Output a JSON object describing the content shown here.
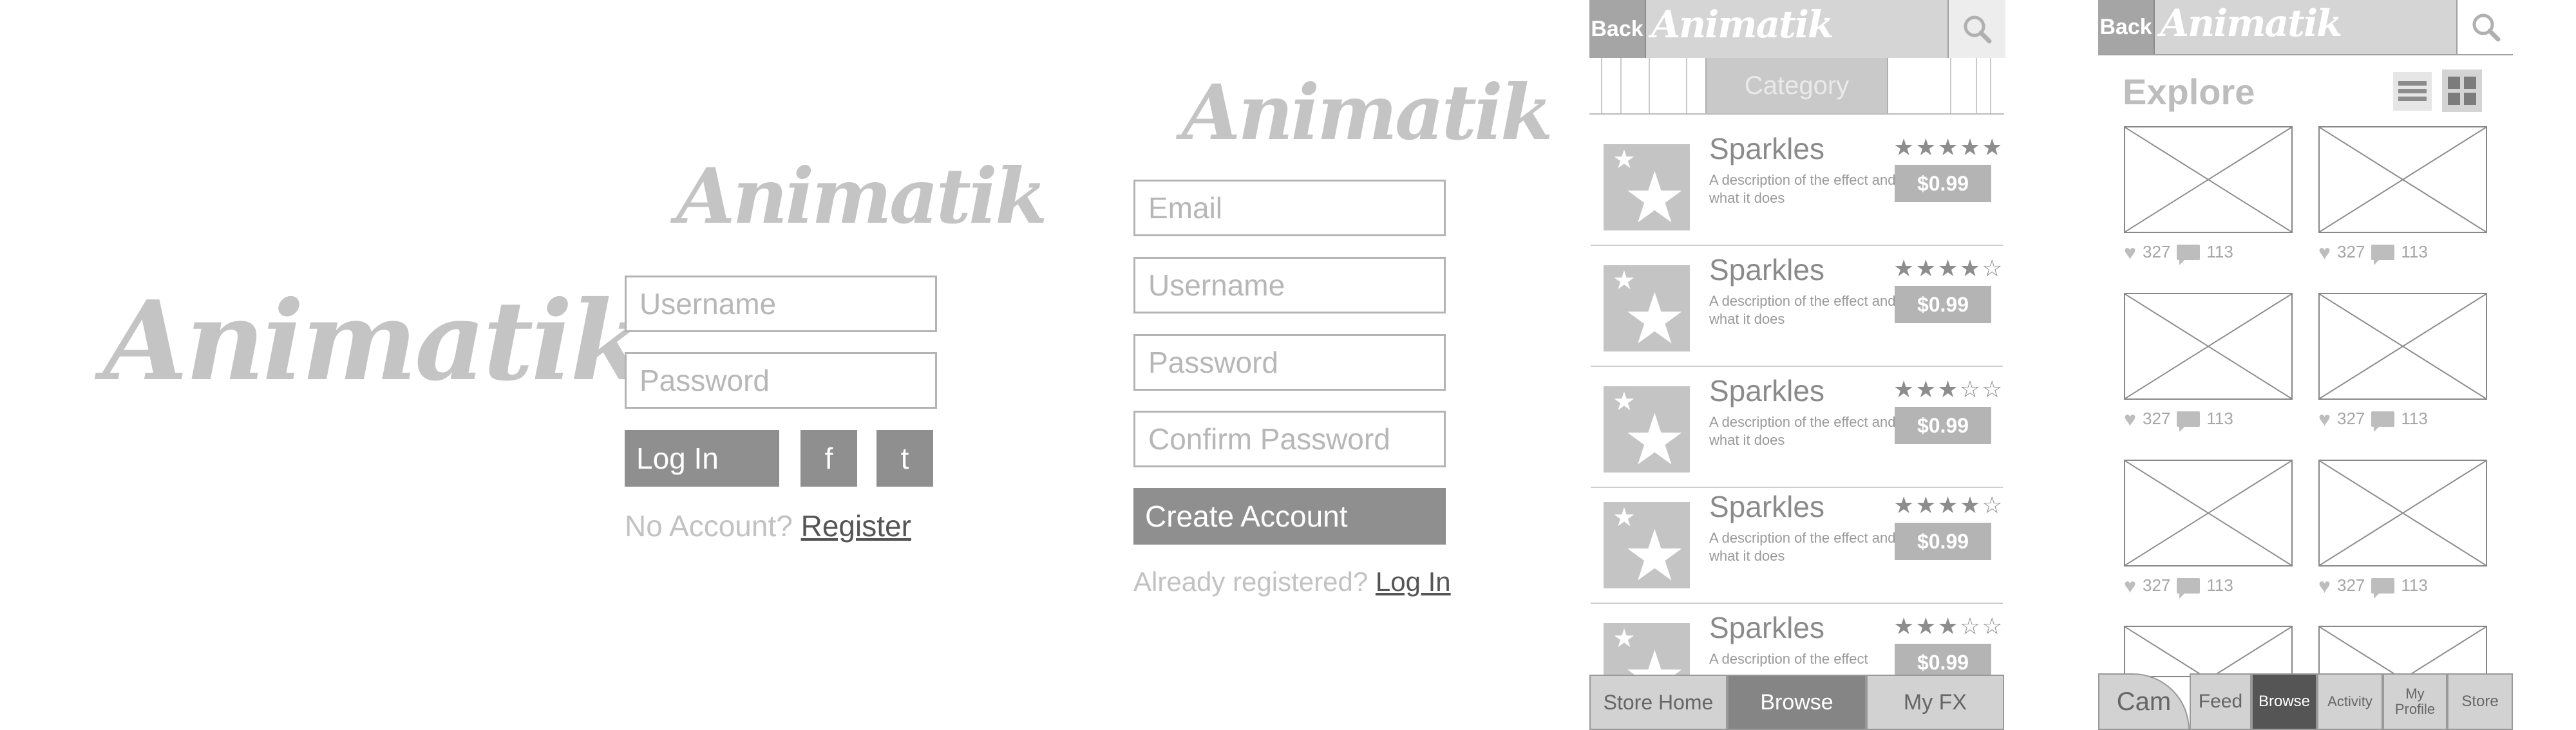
{
  "brand": {
    "logo_text": "Animatik"
  },
  "login": {
    "username_placeholder": "Username",
    "password_placeholder": "Password",
    "login_label": "Log In",
    "facebook_label": "f",
    "twitter_label": "t",
    "no_account_text": "No Account?",
    "register_link": "Register"
  },
  "signup": {
    "email_placeholder": "Email",
    "username_placeholder": "Username",
    "password_placeholder": "Password",
    "confirm_placeholder": "Confirm Password",
    "create_label": "Create Account",
    "already_text": "Already registered?",
    "login_link": "Log In"
  },
  "store": {
    "back_label": "Back",
    "category_label": "Category",
    "items": [
      {
        "title": "Sparkles",
        "desc": "A description of the effect and what it does",
        "rating": 5,
        "price": "$0.99"
      },
      {
        "title": "Sparkles",
        "desc": "A description of the effect and what it does",
        "rating": 4,
        "price": "$0.99"
      },
      {
        "title": "Sparkles",
        "desc": "A description of the effect and what it does",
        "rating": 3,
        "price": "$0.99"
      },
      {
        "title": "Sparkles",
        "desc": "A description of the effect and what it does",
        "rating": 4,
        "price": "$0.99"
      },
      {
        "title": "Sparkles",
        "desc": "A description of the effect",
        "rating": 3,
        "price": "$0.99"
      }
    ],
    "tabs": [
      "Store Home",
      "Browse",
      "My FX"
    ],
    "active_tab": "Browse"
  },
  "explore": {
    "back_label": "Back",
    "title": "Explore",
    "likes": "327",
    "comments": "113",
    "tabs": [
      "Cam",
      "Feed",
      "Browse",
      "Activity",
      "My Profile",
      "Store"
    ],
    "active_tab": "Browse"
  },
  "icons": {
    "search": "search-icon",
    "list": "list-view-icon",
    "grid": "grid-view-icon",
    "heart": "heart-icon",
    "comment": "comment-icon",
    "star": "star-icon"
  }
}
